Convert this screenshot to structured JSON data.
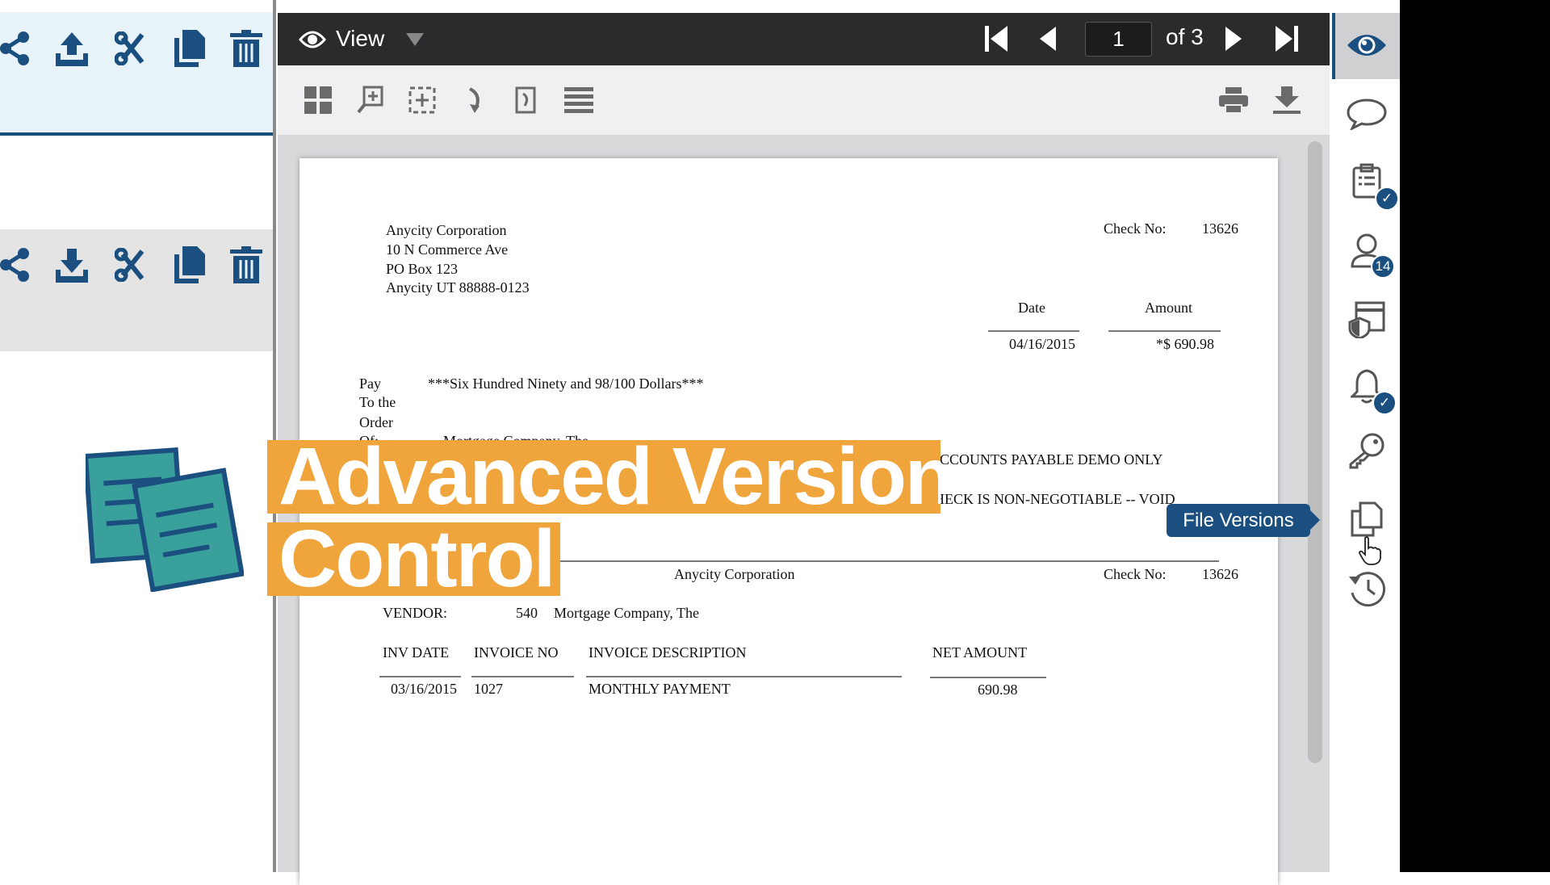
{
  "left_panel": {
    "toolbar1_icons": [
      "share-icon",
      "upload-icon",
      "cut-icon",
      "copy-icon",
      "delete-icon"
    ],
    "toolbar2_icons": [
      "share-icon",
      "download-icon",
      "cut-icon",
      "copy-icon",
      "delete-icon"
    ]
  },
  "viewer": {
    "mode_label": "View",
    "page_current": "1",
    "page_of": "of 3",
    "toolbar_icons": [
      "thumbnails-icon",
      "zoom-in-icon",
      "fit-selection-icon",
      "rotate-icon",
      "rotate-page-icon",
      "list-icon",
      "print-icon",
      "download-icon"
    ]
  },
  "document": {
    "company": "Anycity Corporation",
    "address1": "10 N Commerce Ave",
    "address2": "PO Box 123",
    "address3": "Anycity  UT  88888-0123",
    "check_no_label": "Check No:",
    "check_no": "13626",
    "date_label": "Date",
    "amount_label": "Amount",
    "date": "04/16/2015",
    "amount": "*$ 690.98",
    "pay_label": "Pay",
    "pay_text": "***Six Hundred Ninety and 98/100 Dollars***",
    "to_the": "To the",
    "order": "Order",
    "of": "Of:",
    "payee": "Mortgage Company, The",
    "demo_line": "ACCOUNTS PAYABLE DEMO ONLY",
    "void_line": "CHECK IS NON-NEGOTIABLE -- VOID",
    "stub_company": "Anycity Corporation",
    "stub_check_no_label": "Check No:",
    "stub_check_no": "13626",
    "vendor_label": "VENDOR:",
    "vendor_no": "540",
    "vendor_name": "Mortgage Company, The",
    "columns": [
      "INV DATE",
      "INVOICE NO",
      "INVOICE DESCRIPTION",
      "NET AMOUNT"
    ],
    "rows": [
      [
        "03/16/2015",
        "1027",
        "MONTHLY PAYMENT",
        "690.98"
      ]
    ]
  },
  "right_sidebar": {
    "items": [
      "view-icon",
      "comments-icon",
      "tasks-icon",
      "users-icon",
      "retention-icon",
      "notifications-icon",
      "permissions-icon",
      "file-versions-icon",
      "history-icon"
    ],
    "users_badge": "14",
    "tooltip": "File Versions",
    "active": "view-icon"
  },
  "overlay": {
    "line1": "Advanced Version",
    "line2": "Control",
    "accent": "#f0a53c"
  },
  "colors": {
    "brand_blue": "#1a4f7f",
    "header_dark": "#2b2b2d"
  }
}
